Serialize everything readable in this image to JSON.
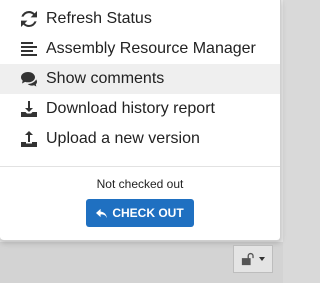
{
  "menu": {
    "items": [
      {
        "label": "Refresh Status",
        "icon": "refresh-icon"
      },
      {
        "label": "Assembly Resource Manager",
        "icon": "list-icon"
      },
      {
        "label": "Show comments",
        "icon": "comments-icon"
      },
      {
        "label": "Download history report",
        "icon": "download-icon"
      },
      {
        "label": "Upload a new version",
        "icon": "upload-icon"
      }
    ]
  },
  "checkout": {
    "status_text": "Not checked out",
    "button_label": "CHECK OUT",
    "button_color": "#1f70c1"
  },
  "toolbar": {
    "lock_icon": "unlock-icon"
  }
}
